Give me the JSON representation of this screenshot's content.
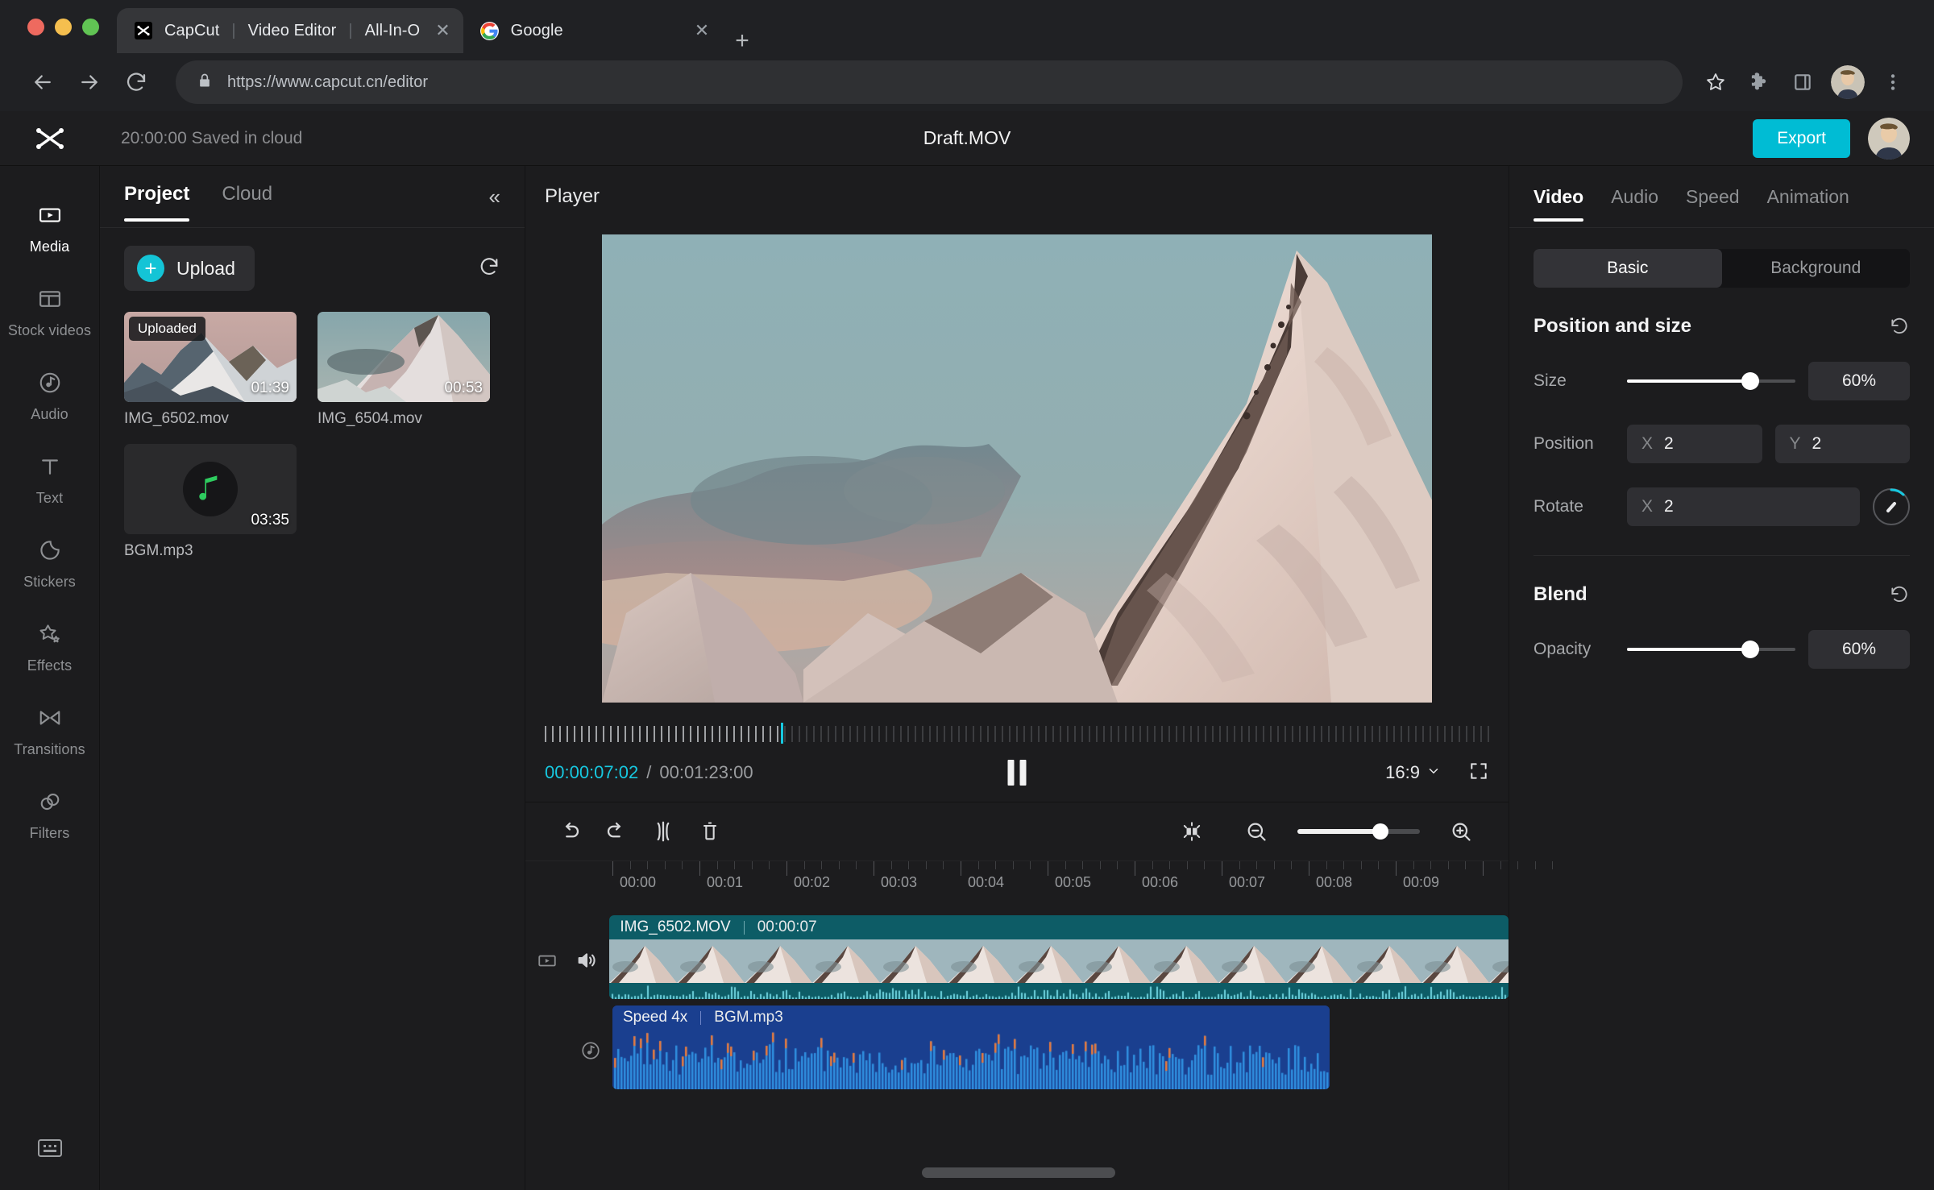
{
  "browser": {
    "tabs": [
      {
        "title_main": "CapCut",
        "title_mid": "Video Editor",
        "title_end": "All-In-O",
        "favicon": "capcut-icon",
        "active": true
      },
      {
        "title_main": "Google",
        "favicon": "google-icon",
        "active": false
      }
    ],
    "new_tab_label": "+",
    "close_label": "✕",
    "url": "https://www.capcut.cn/editor",
    "lock_icon": "lock-icon",
    "back_icon": "back-arrow-icon",
    "forward_icon": "forward-arrow-icon",
    "reload_icon": "reload-icon",
    "star_icon": "bookmark-star-icon",
    "extensions_icon": "puzzle-piece-icon",
    "sidepanel_icon": "side-panel-icon",
    "menu_icon": "three-dot-menu-icon"
  },
  "header": {
    "logo": "capcut-logo",
    "saved_status": "20:00:00 Saved in cloud",
    "draft_title": "Draft.MOV",
    "export_label": "Export",
    "avatar": "user-avatar"
  },
  "rail": {
    "items": [
      {
        "label": "Media",
        "icon": "media-icon",
        "active": true
      },
      {
        "label": "Stock videos",
        "icon": "stock-videos-icon",
        "active": false
      },
      {
        "label": "Audio",
        "icon": "audio-note-icon",
        "active": false
      },
      {
        "label": "Text",
        "icon": "text-icon",
        "active": false
      },
      {
        "label": "Stickers",
        "icon": "stickers-icon",
        "active": false
      },
      {
        "label": "Effects",
        "icon": "effects-star-icon",
        "active": false
      },
      {
        "label": "Transitions",
        "icon": "transitions-icon",
        "active": false
      },
      {
        "label": "Filters",
        "icon": "filters-icon",
        "active": false
      }
    ],
    "bottom_icon": "captions-icon"
  },
  "project_panel": {
    "tabs": [
      {
        "label": "Project",
        "active": true
      },
      {
        "label": "Cloud",
        "active": false
      }
    ],
    "collapse_icon": "collapse-double-chevron-left-icon",
    "upload_label": "Upload",
    "upload_plus": "+",
    "refresh_icon": "refresh-icon",
    "media": [
      {
        "name": "IMG_6502.mov",
        "duration": "01:39",
        "badge": "Uploaded",
        "type": "video"
      },
      {
        "name": "IMG_6504.mov",
        "duration": "00:53",
        "badge": "",
        "type": "video"
      },
      {
        "name": "BGM.mp3",
        "duration": "03:35",
        "badge": "",
        "type": "audio"
      }
    ]
  },
  "player": {
    "label": "Player",
    "current_time": "00:00:07:02",
    "separator": "/",
    "total_time": "00:01:23:00",
    "play_state_icon": "pause-icon",
    "aspect_ratio": "16:9",
    "aspect_chevron": "chevron-down-icon",
    "fullscreen_icon": "fullscreen-icon",
    "progress_percent": 25
  },
  "timeline": {
    "tools": [
      {
        "name": "undo",
        "icon": "undo-icon"
      },
      {
        "name": "redo",
        "icon": "redo-icon"
      },
      {
        "name": "split",
        "icon": "split-icon"
      },
      {
        "name": "delete",
        "icon": "trash-icon"
      }
    ],
    "fit_icon": "fit-to-screen-icon",
    "zoom_out_icon": "zoom-out-icon",
    "zoom_in_icon": "zoom-in-icon",
    "zoom_level_percent": 68,
    "ruler_labels": [
      "00:00",
      "00:01",
      "00:02",
      "00:03",
      "00:04",
      "00:05",
      "00:06",
      "00:07",
      "00:08",
      "00:09"
    ],
    "tracks": [
      {
        "type": "video",
        "head_icons": [
          "video-track-icon",
          "volume-on-icon"
        ],
        "clip_title": "IMG_6502.MOV",
        "clip_time": "00:00:07"
      },
      {
        "type": "audio",
        "head_icons": [
          "audio-track-icon"
        ],
        "clip_badge": "Speed 4x",
        "clip_title": "BGM.mp3"
      }
    ]
  },
  "inspector": {
    "tabs": [
      {
        "label": "Video",
        "active": true
      },
      {
        "label": "Audio",
        "active": false
      },
      {
        "label": "Speed",
        "active": false
      },
      {
        "label": "Animation",
        "active": false
      }
    ],
    "segments": [
      {
        "label": "Basic",
        "active": true
      },
      {
        "label": "Background",
        "active": false
      }
    ],
    "position_size": {
      "title": "Position and size",
      "reset_icon": "reset-icon",
      "size_label": "Size",
      "size_value": "60%",
      "size_percent": 73,
      "position_label": "Position",
      "position_x_axis": "X",
      "position_x_value": "2",
      "position_y_axis": "Y",
      "position_y_value": "2",
      "rotate_label": "Rotate",
      "rotate_x_axis": "X",
      "rotate_x_value": "2",
      "rotate_dial_icon": "rotate-dial-icon"
    },
    "blend": {
      "title": "Blend",
      "reset_icon": "reset-icon",
      "opacity_label": "Opacity",
      "opacity_value": "60%",
      "opacity_percent": 73
    }
  },
  "colors": {
    "accent": "#00bcd4",
    "playhead": "#17c8e0",
    "video_clip": "#0d5c66",
    "audio_clip": "#1a3f8f",
    "audio_note_green": "#2ecc5f"
  }
}
